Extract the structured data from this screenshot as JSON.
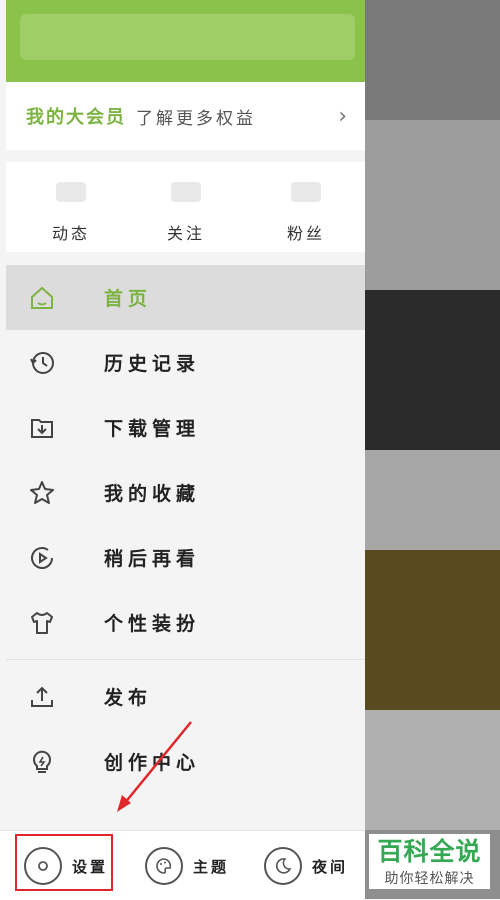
{
  "member": {
    "title": "我的大会员",
    "subtitle": "了解更多权益"
  },
  "stats": [
    {
      "label": "动态"
    },
    {
      "label": "关注"
    },
    {
      "label": "粉丝"
    }
  ],
  "menu": {
    "items": [
      {
        "label": "首页",
        "icon": "home-icon",
        "active": true
      },
      {
        "label": "历史记录",
        "icon": "history-icon"
      },
      {
        "label": "下载管理",
        "icon": "download-icon"
      },
      {
        "label": "我的收藏",
        "icon": "star-icon"
      },
      {
        "label": "稍后再看",
        "icon": "watch-later-icon"
      },
      {
        "label": "个性装扮",
        "icon": "shirt-icon"
      }
    ],
    "items2": [
      {
        "label": "发布",
        "icon": "upload-icon"
      },
      {
        "label": "创作中心",
        "icon": "bulb-icon"
      }
    ]
  },
  "bottom": {
    "settings": "设置",
    "theme": "主题",
    "night": "夜间"
  },
  "watermark": {
    "title": "百科全说",
    "subtitle": "助你轻松解决"
  },
  "colors": {
    "accent": "#7cb342",
    "header": "#8bc34a",
    "highlight": "#e0262a"
  }
}
